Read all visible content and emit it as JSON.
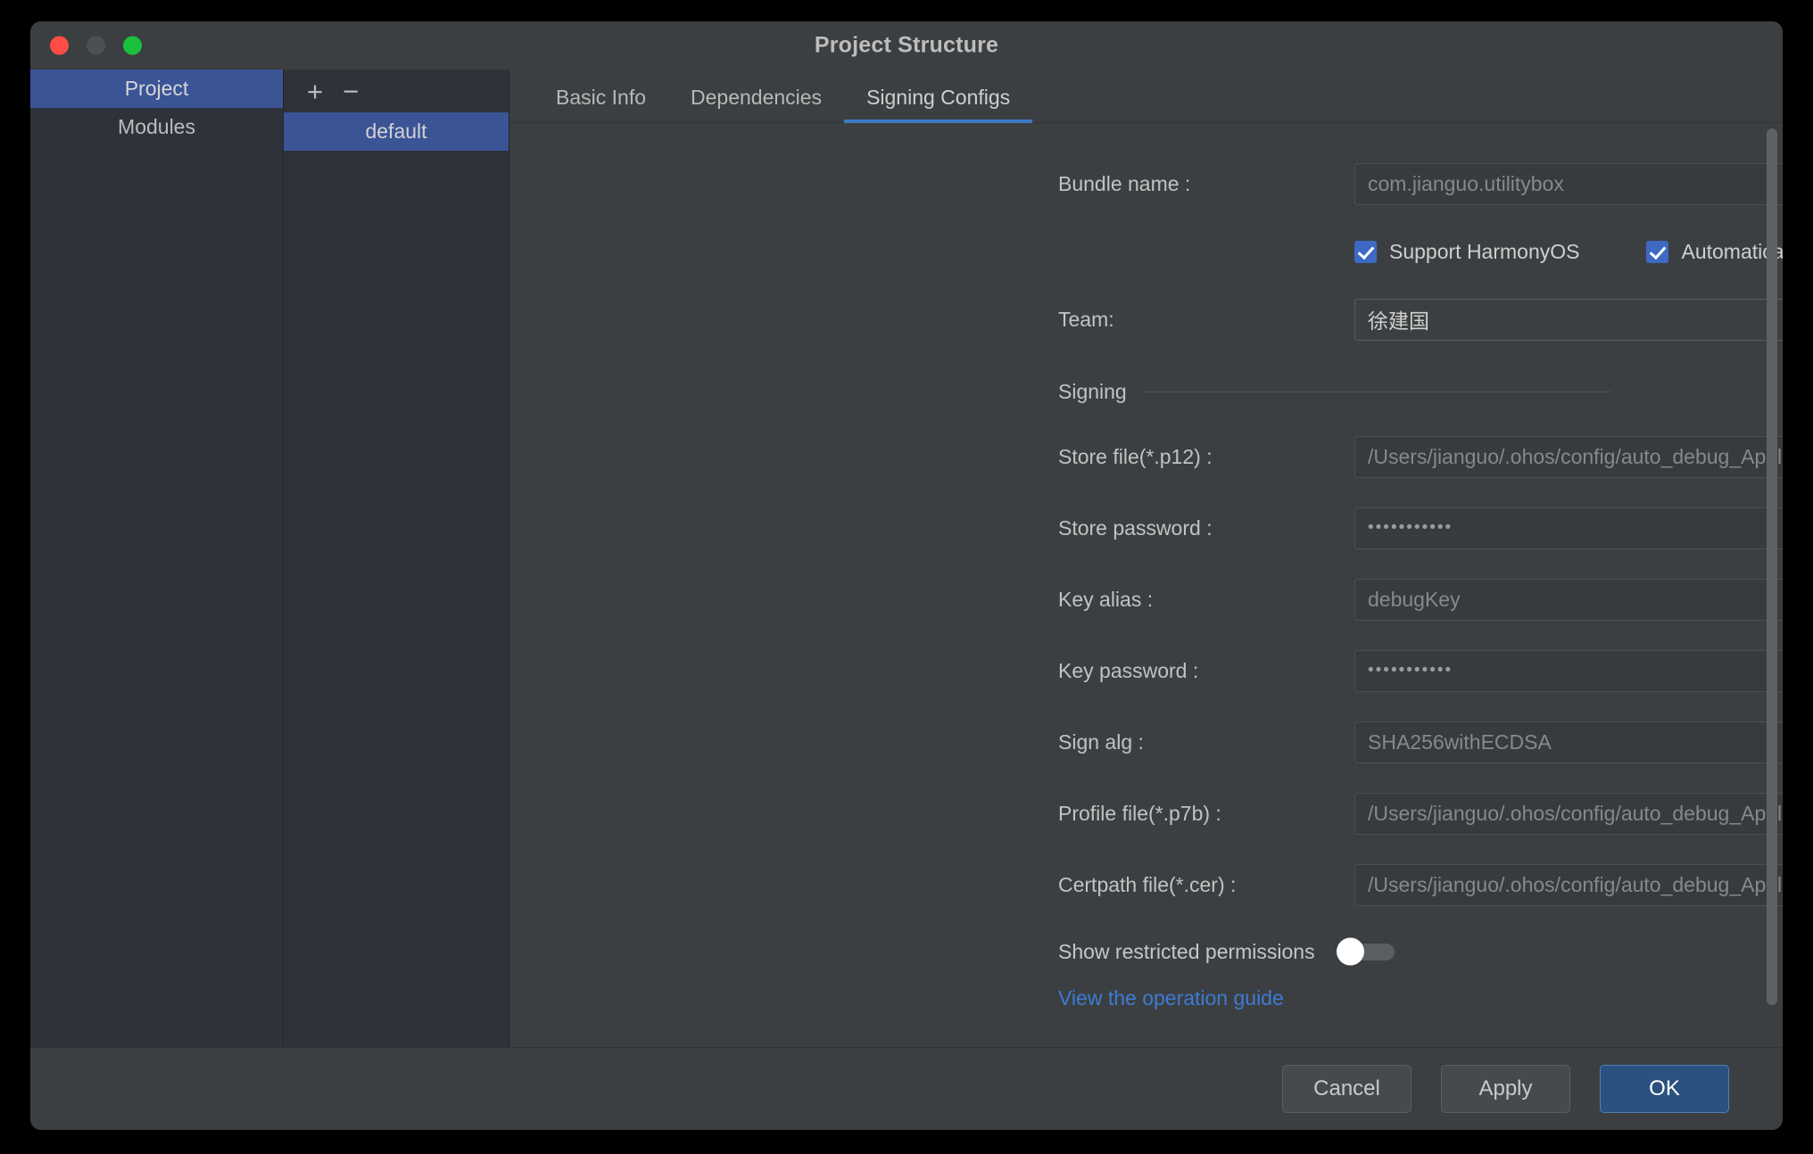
{
  "window": {
    "title": "Project Structure",
    "traffic_lights": [
      "close-red",
      "minimize-grey",
      "maximize-green"
    ]
  },
  "sidebar": {
    "items": [
      {
        "label": "Project",
        "selected": true
      },
      {
        "label": "Modules",
        "selected": false
      }
    ]
  },
  "config_list": {
    "add_label": "+",
    "remove_label": "−",
    "items": [
      {
        "label": "default",
        "selected": true
      }
    ]
  },
  "tabs": [
    {
      "label": "Basic Info",
      "active": false
    },
    {
      "label": "Dependencies",
      "active": false
    },
    {
      "label": "Signing Configs",
      "active": true
    }
  ],
  "form": {
    "bundle_name": {
      "label": "Bundle name :",
      "value": "com.jianguo.utilitybox"
    },
    "checkboxes": [
      {
        "label": "Support HarmonyOS",
        "checked": true
      },
      {
        "label": "Automatically generate signature",
        "checked": true
      }
    ],
    "team": {
      "label": "Team:",
      "value": "徐建国"
    },
    "section_signing": "Signing",
    "store_file": {
      "label": "Store file(*.p12) :",
      "value": "/Users/jianguo/.ohos/config/auto_debug_Application_com.jianguo.utilitybox_"
    },
    "store_password": {
      "label": "Store password :",
      "value": "•••••••••••"
    },
    "key_alias": {
      "label": "Key alias :",
      "value": "debugKey"
    },
    "key_password": {
      "label": "Key password :",
      "value": "•••••••••••"
    },
    "sign_alg": {
      "label": "Sign alg :",
      "value": "SHA256withECDSA"
    },
    "profile_file": {
      "label": "Profile file(*.p7b) :",
      "value": "/Users/jianguo/.ohos/config/auto_debug_Application_com.jianguo.utilitybox_"
    },
    "certpath_file": {
      "label": "Certpath file(*.cer) :",
      "value": "/Users/jianguo/.ohos/config/auto_debug_Application_com.jianguo.utilitybox_"
    },
    "show_restricted_permissions": {
      "label": "Show restricted permissions",
      "enabled": false
    },
    "guide_link": "View the operation guide"
  },
  "icons": {
    "edit": "pencil-icon",
    "fingerprint": "fingerprint-icon",
    "help": "question-mark-icon",
    "folder": "folder-icon"
  },
  "footer": {
    "cancel": "Cancel",
    "apply": "Apply",
    "ok": "OK"
  },
  "colors": {
    "accent_blue": "#3e69c4",
    "tab_underline": "#3d79c4",
    "primary_button": "#2b5180",
    "link": "#3d7bd4"
  }
}
